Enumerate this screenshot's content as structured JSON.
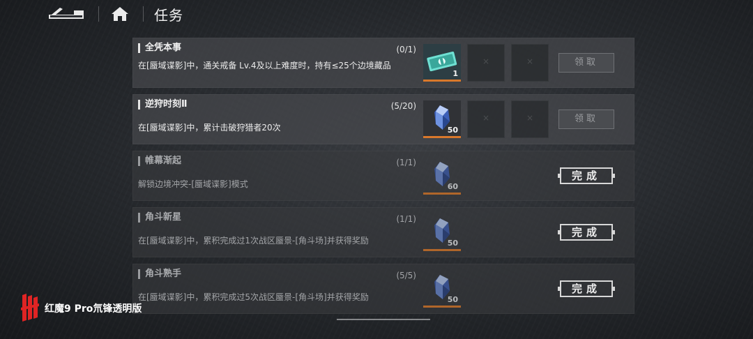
{
  "header": {
    "title": "任务"
  },
  "tasks": [
    {
      "title": "全凭本事",
      "progress": "(0/1)",
      "description": "在[蜃域谍影]中，通关戒备 Lv.4及以上难度时，持有≤25个边境藏品",
      "reward": {
        "icon": "ticket-icon",
        "count": "1"
      },
      "action_label": "领取",
      "completed": false
    },
    {
      "title": "逆狩时刻Ⅱ",
      "progress": "(5/20)",
      "description": "在[蜃域谍影]中，累计击破狩猎者20次",
      "reward": {
        "icon": "crystal-icon",
        "count": "50"
      },
      "action_label": "领取",
      "completed": false
    },
    {
      "title": "帷幕渐起",
      "progress": "(1/1)",
      "description": "解锁边境冲突-[蜃域谍影]模式",
      "reward": {
        "icon": "crystal-icon",
        "count": "60"
      },
      "action_label": "完成",
      "completed": true
    },
    {
      "title": "角斗新星",
      "progress": "(1/1)",
      "description": "在[蜃域谍影]中，累积完成过1次战区蜃景-[角斗场]并获得奖励",
      "reward": {
        "icon": "crystal-icon",
        "count": "50"
      },
      "action_label": "完成",
      "completed": true
    },
    {
      "title": "角斗熟手",
      "progress": "(5/5)",
      "description": "在[蜃域谍影]中，累积完成过5次战区蜃景-[角斗场]并获得奖励",
      "reward": {
        "icon": "crystal-icon",
        "count": "50"
      },
      "action_label": "完成",
      "completed": true
    }
  ],
  "watermark": {
    "text": "红魔9 Pro氘锋透明版"
  },
  "colors": {
    "accent_orange": "#d9782b",
    "ticket_teal": "#5fd3c6",
    "crystal_blue": "#5a7fd6"
  }
}
